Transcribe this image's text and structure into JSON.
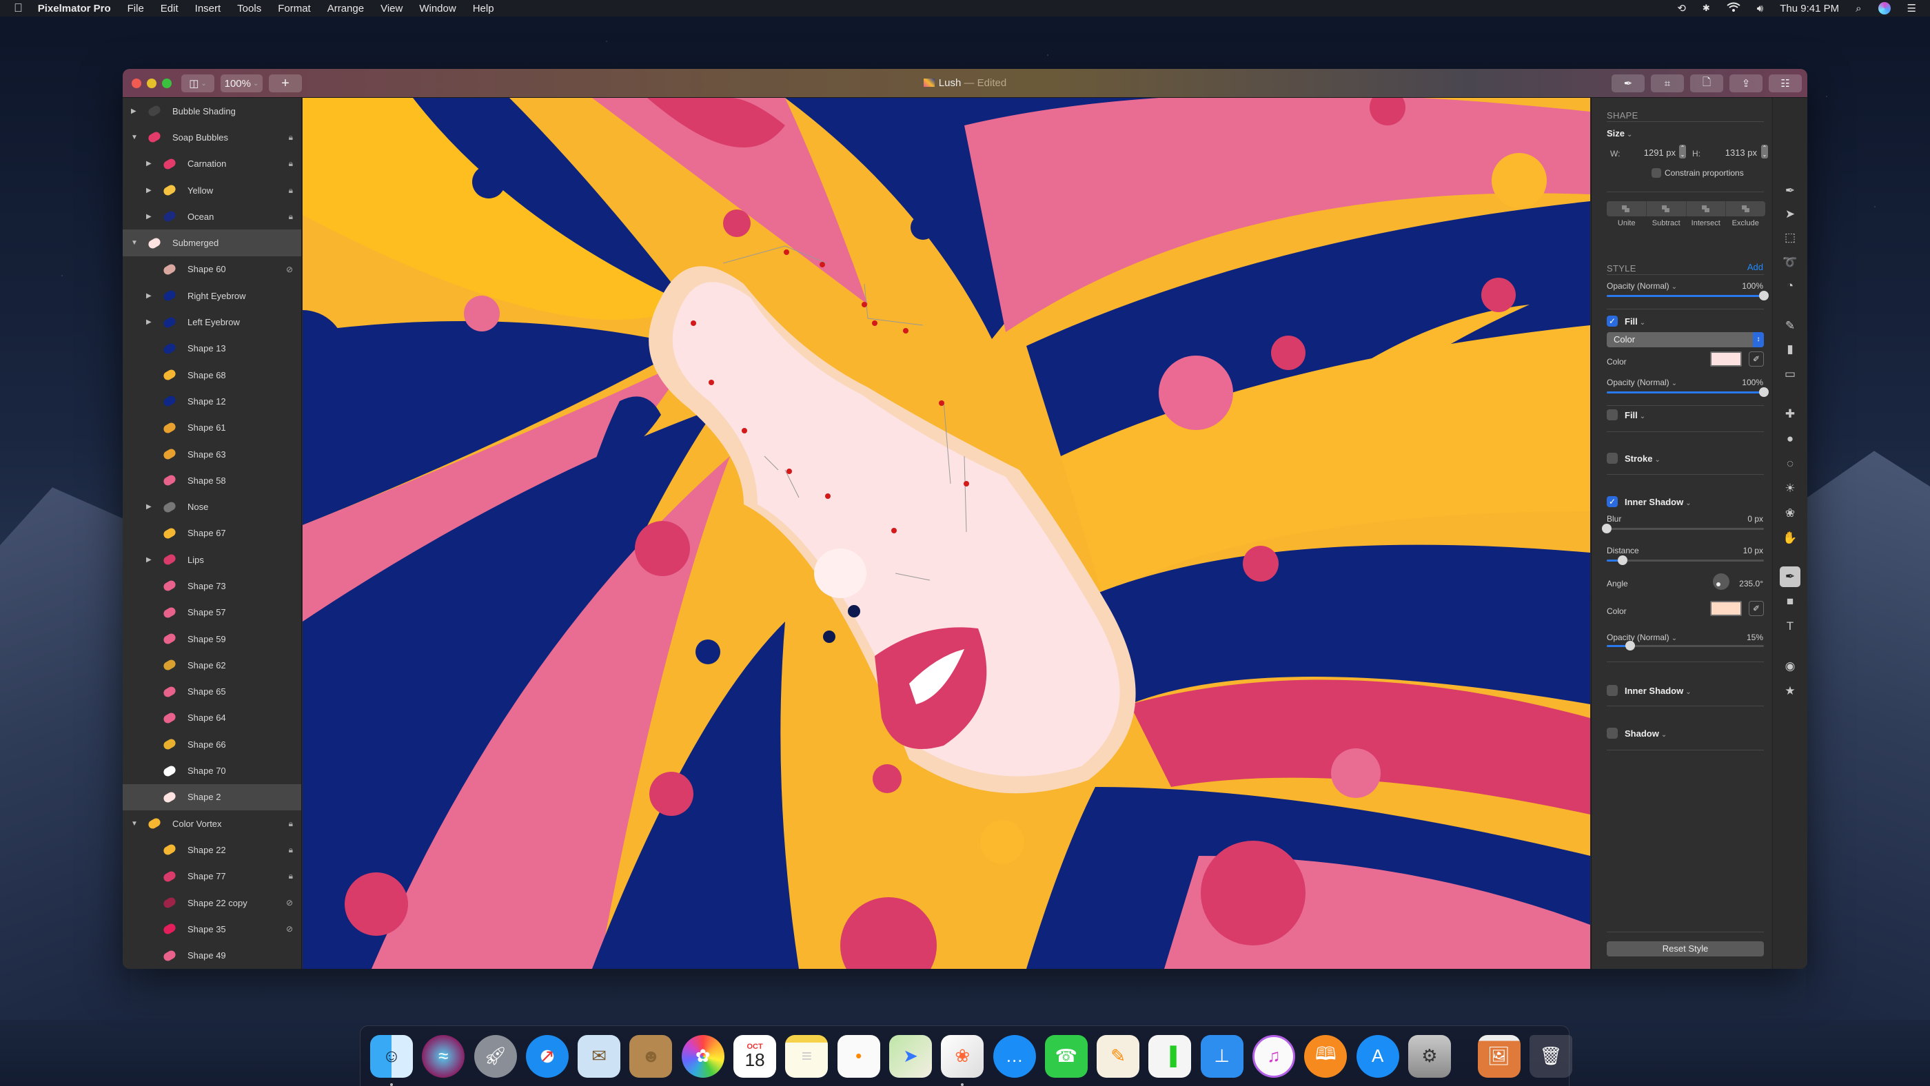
{
  "menubar": {
    "app_name": "Pixelmator Pro",
    "menus": [
      "File",
      "Edit",
      "Insert",
      "Tools",
      "Format",
      "Arrange",
      "View",
      "Window",
      "Help"
    ],
    "clock": "Thu 9:41 PM",
    "status_icons": [
      "time-machine-icon",
      "bluetooth-icon",
      "wifi-icon",
      "volume-icon",
      "spotlight-icon",
      "siri-icon",
      "notification-center-icon"
    ]
  },
  "window": {
    "title": "Lush",
    "title_status": "— Edited",
    "zoom_value": "100%",
    "toolbar_right": [
      "style-tool",
      "crop-tool",
      "document-tool",
      "share-tool",
      "adjust-tool"
    ]
  },
  "layers": [
    {
      "name": "Bubble Shading",
      "level": 0,
      "disclosure": "collapsed",
      "badge": ""
    },
    {
      "name": "Soap Bubbles",
      "level": 0,
      "disclosure": "expanded",
      "badge": "lock"
    },
    {
      "name": "Carnation",
      "level": 1,
      "disclosure": "collapsed",
      "badge": "lock"
    },
    {
      "name": "Yellow",
      "level": 1,
      "disclosure": "collapsed",
      "badge": "lock"
    },
    {
      "name": "Ocean",
      "level": 1,
      "disclosure": "collapsed",
      "badge": "lock"
    },
    {
      "name": "Submerged",
      "level": 0,
      "disclosure": "expanded",
      "badge": "",
      "selected": true
    },
    {
      "name": "Shape 60",
      "level": 1,
      "disclosure": "none",
      "badge": "hidden"
    },
    {
      "name": "Right Eyebrow",
      "level": 1,
      "disclosure": "collapsed",
      "badge": ""
    },
    {
      "name": "Left Eyebrow",
      "level": 1,
      "disclosure": "collapsed",
      "badge": ""
    },
    {
      "name": "Shape 13",
      "level": 1,
      "disclosure": "none",
      "badge": ""
    },
    {
      "name": "Shape 68",
      "level": 1,
      "disclosure": "none",
      "badge": ""
    },
    {
      "name": "Shape 12",
      "level": 1,
      "disclosure": "none",
      "badge": ""
    },
    {
      "name": "Shape 61",
      "level": 1,
      "disclosure": "none",
      "badge": ""
    },
    {
      "name": "Shape 63",
      "level": 1,
      "disclosure": "none",
      "badge": ""
    },
    {
      "name": "Shape 58",
      "level": 1,
      "disclosure": "none",
      "badge": ""
    },
    {
      "name": "Nose",
      "level": 1,
      "disclosure": "collapsed",
      "badge": ""
    },
    {
      "name": "Shape 67",
      "level": 1,
      "disclosure": "none",
      "badge": ""
    },
    {
      "name": "Lips",
      "level": 1,
      "disclosure": "collapsed",
      "badge": ""
    },
    {
      "name": "Shape 73",
      "level": 1,
      "disclosure": "none",
      "badge": ""
    },
    {
      "name": "Shape 57",
      "level": 1,
      "disclosure": "none",
      "badge": ""
    },
    {
      "name": "Shape 59",
      "level": 1,
      "disclosure": "none",
      "badge": ""
    },
    {
      "name": "Shape 62",
      "level": 1,
      "disclosure": "none",
      "badge": ""
    },
    {
      "name": "Shape 65",
      "level": 1,
      "disclosure": "none",
      "badge": ""
    },
    {
      "name": "Shape 64",
      "level": 1,
      "disclosure": "none",
      "badge": ""
    },
    {
      "name": "Shape 66",
      "level": 1,
      "disclosure": "none",
      "badge": ""
    },
    {
      "name": "Shape 70",
      "level": 1,
      "disclosure": "none",
      "badge": ""
    },
    {
      "name": "Shape 2",
      "level": 1,
      "disclosure": "none",
      "badge": "",
      "selected": true
    },
    {
      "name": "Color Vortex",
      "level": 0,
      "disclosure": "expanded",
      "badge": "lock"
    },
    {
      "name": "Shape 22",
      "level": 1,
      "disclosure": "none",
      "badge": "lock"
    },
    {
      "name": "Shape 77",
      "level": 1,
      "disclosure": "none",
      "badge": "lock"
    },
    {
      "name": "Shape 22 copy",
      "level": 1,
      "disclosure": "none",
      "badge": "hidden"
    },
    {
      "name": "Shape 35",
      "level": 1,
      "disclosure": "none",
      "badge": "hidden"
    },
    {
      "name": "Shape 49",
      "level": 1,
      "disclosure": "none",
      "badge": ""
    }
  ],
  "layer_thumb_colors": [
    "#444",
    "#e33b6a",
    "#e33b6a",
    "#f5c242",
    "#1a2a80",
    "#fde3e1",
    "#d9a7a0",
    "#0f2787",
    "#0f2787",
    "#0f2787",
    "#f5b731",
    "#0f2787",
    "#e8a02e",
    "#e8a02e",
    "#e8628c",
    "#777",
    "#f5b731",
    "#d93c6a",
    "#e8628c",
    "#e8628c",
    "#e8628c",
    "#d9a030",
    "#e8628c",
    "#e8628c",
    "#e8b02e",
    "#ffffff",
    "#fde3e1",
    "#f5b731",
    "#f5b731",
    "#d93c6a",
    "#9e2348",
    "#e31e5b",
    "#e8628c"
  ],
  "inspector": {
    "shape_header": "SHAPE",
    "size_label": "Size",
    "width_label": "W:",
    "width_value": "1291 px",
    "height_label": "H:",
    "height_value": "1313 px",
    "constrain_label": "Constrain proportions",
    "constrain_checked": false,
    "boolean_ops": [
      "Unite",
      "Subtract",
      "Intersect",
      "Exclude"
    ],
    "style_header": "STYLE",
    "add_label": "Add",
    "opacity_label": "Opacity (Normal)",
    "opacity_value": "100%",
    "opacity_fraction": 1.0,
    "fill1": {
      "label": "Fill",
      "checked": true,
      "type": "Color",
      "color_label": "Color",
      "color": "#fde2e2",
      "opacity_label": "Opacity (Normal)",
      "opacity_value": "100%",
      "opacity_fraction": 1.0
    },
    "fill2": {
      "label": "Fill",
      "checked": false
    },
    "stroke": {
      "label": "Stroke",
      "checked": false
    },
    "inner_shadow1": {
      "label": "Inner Shadow",
      "checked": true,
      "blur_label": "Blur",
      "blur_value": "0 px",
      "blur_fraction": 0.0,
      "distance_label": "Distance",
      "distance_value": "10 px",
      "distance_fraction": 0.1,
      "angle_label": "Angle",
      "angle_value": "235.0°",
      "color_label": "Color",
      "color": "#ffdac4",
      "opacity_label": "Opacity (Normal)",
      "opacity_value": "15%",
      "opacity_fraction": 0.15
    },
    "inner_shadow2": {
      "label": "Inner Shadow",
      "checked": false
    },
    "shadow": {
      "label": "Shadow",
      "checked": false
    },
    "reset_label": "Reset Style"
  },
  "tools": [
    "style-brush",
    "arrange",
    "selection-rect",
    "selection-lasso",
    "quick-selection",
    "paint",
    "paint-bucket",
    "erase",
    "repair",
    "clone",
    "blur",
    "light",
    "color-adjust",
    "warp",
    "pen",
    "shape",
    "type",
    "color-picker",
    "effects"
  ],
  "active_tool": "pen",
  "dock": {
    "apps": [
      {
        "name": "Finder",
        "running": true
      },
      {
        "name": "Siri"
      },
      {
        "name": "Launchpad"
      },
      {
        "name": "Safari"
      },
      {
        "name": "Mail"
      },
      {
        "name": "Contacts"
      },
      {
        "name": "Photos"
      },
      {
        "name": "Calendar",
        "month": "OCT",
        "day": "18"
      },
      {
        "name": "Notes"
      },
      {
        "name": "Reminders"
      },
      {
        "name": "Maps"
      },
      {
        "name": "Pixelmator Pro",
        "running": true
      },
      {
        "name": "Messages"
      },
      {
        "name": "FaceTime"
      },
      {
        "name": "Pages"
      },
      {
        "name": "Numbers"
      },
      {
        "name": "Keynote"
      },
      {
        "name": "iTunes"
      },
      {
        "name": "Books"
      },
      {
        "name": "App Store"
      },
      {
        "name": "System Preferences"
      }
    ],
    "stack": "Downloads",
    "trash": "Trash"
  }
}
